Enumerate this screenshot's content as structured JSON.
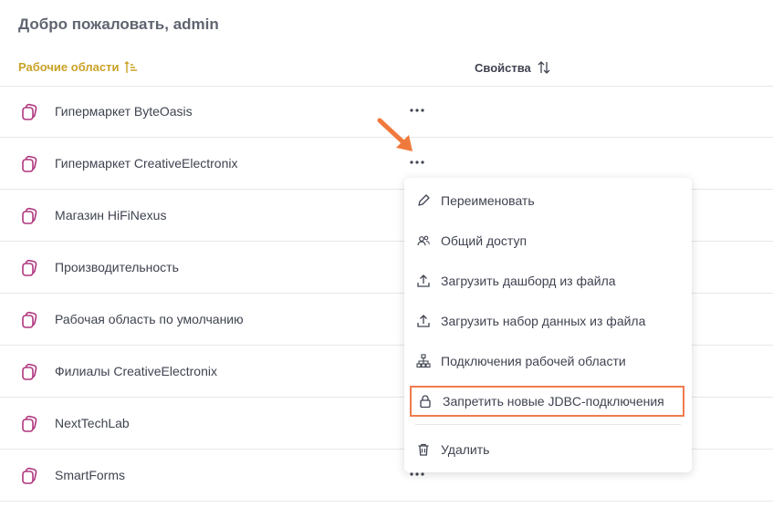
{
  "welcome": "Добро пожаловать, admin",
  "columns": {
    "workspaces": "Рабочие области",
    "properties": "Свойства"
  },
  "workspaces": [
    "Гипермаркет ByteOasis",
    "Гипермаркет CreativeElectronix",
    "Магазин HiFiNexus",
    "Производительность",
    "Рабочая область по умолчанию",
    "Филиалы CreativeElectronix",
    "NextTechLab",
    "SmartForms"
  ],
  "menu": {
    "rename": "Переименовать",
    "share": "Общий доступ",
    "upload_dashboard": "Загрузить дашборд из файла",
    "upload_dataset": "Загрузить набор данных из файла",
    "connections": "Подключения рабочей области",
    "block_jdbc": "Запретить новые JDBC-подключения",
    "delete": "Удалить"
  },
  "colors": {
    "accent": "#c9a227",
    "workspace_icon": "#b0367e",
    "highlight": "#ef7c4e"
  }
}
